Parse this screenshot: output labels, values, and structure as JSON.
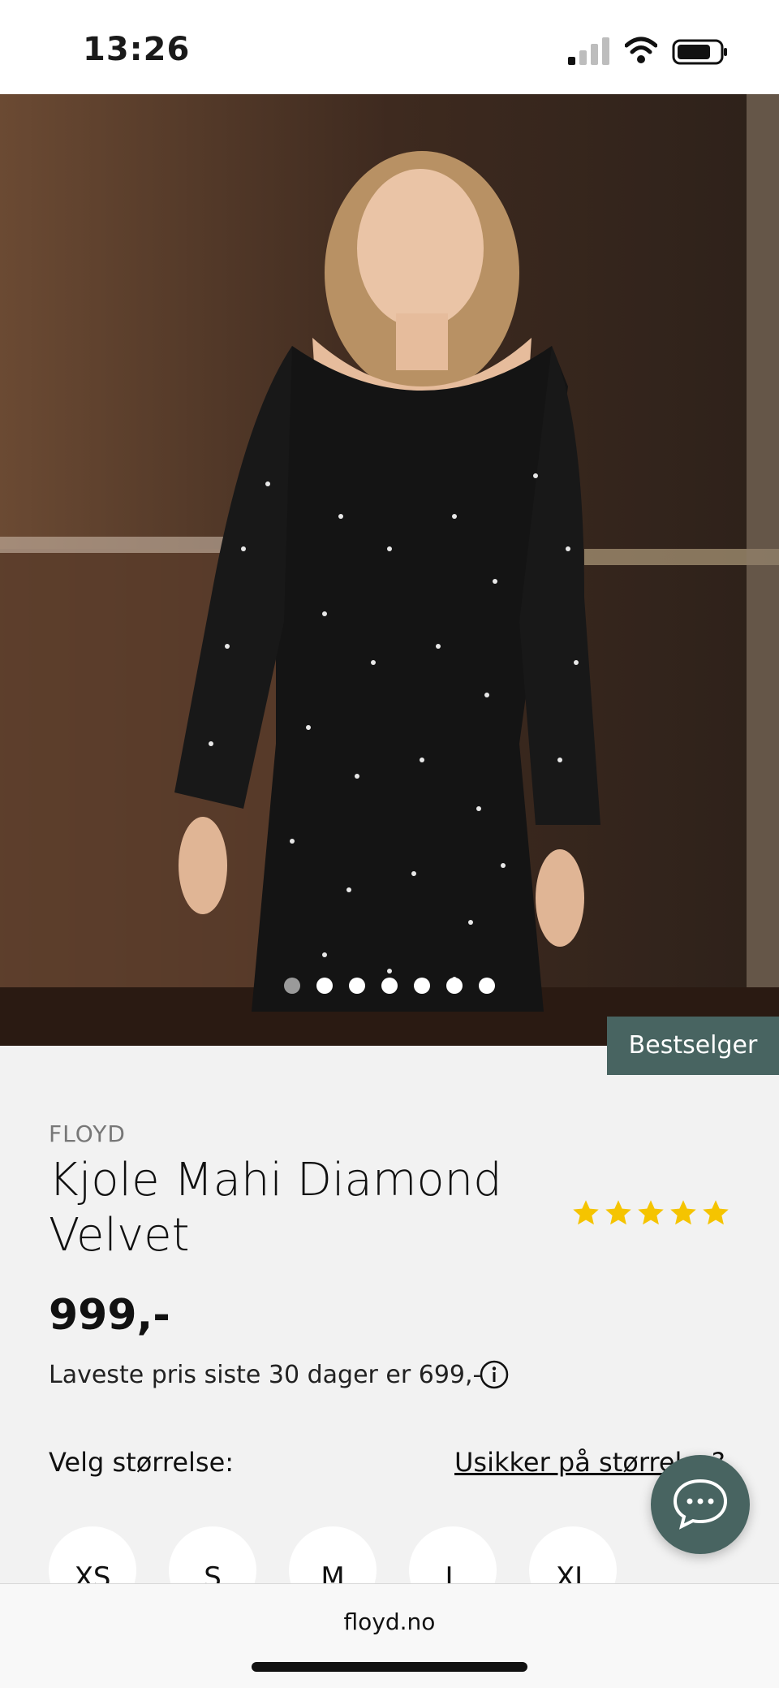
{
  "status_bar": {
    "time": "13:26",
    "battery_icon": "battery-icon",
    "wifi_icon": "wifi-icon",
    "signal_icon": "signal-icon"
  },
  "product": {
    "badge": "Bestselger",
    "brand": "FLOYD",
    "title": "Kjole Mahi Diamond Velvet",
    "rating_stars": 5,
    "price": "999,-",
    "lowest_price_note": "Laveste pris siste 30 dager er 699,-",
    "image_count": 7,
    "active_image_index": 0
  },
  "size_selector": {
    "label": "Velg størrelse:",
    "help_link": "Usikker på størrelse?",
    "options": [
      "XS",
      "S",
      "M",
      "L",
      "XL"
    ]
  },
  "browser": {
    "url": "floyd.no"
  },
  "colors": {
    "accent": "#486461",
    "star": "#f5c400",
    "background": "#f2f2f2"
  }
}
